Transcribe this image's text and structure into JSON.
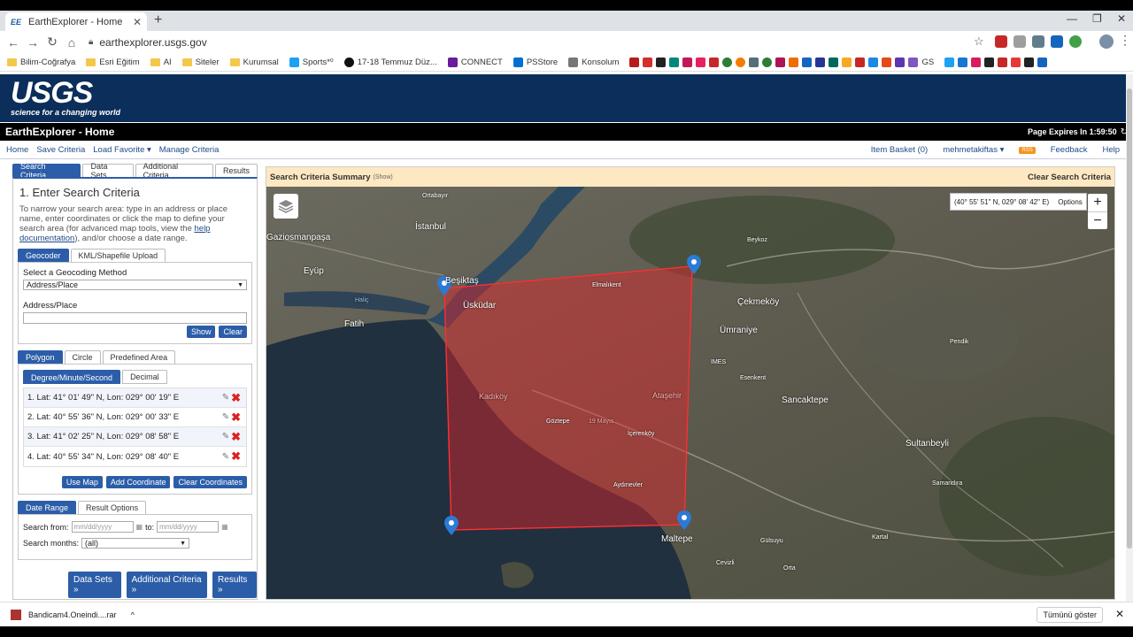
{
  "browser": {
    "tab_title": "EarthExplorer - Home",
    "tab_favicon": "EE",
    "url": "earthexplorer.usgs.gov",
    "bookmarks": [
      "Bilim-Coğrafya",
      "Esri Eğitim",
      "AI",
      "Siteler",
      "Kurumsal",
      "Sports*⁰",
      "17-18 Temmuz Düz...",
      "CONNECT",
      "PSStore",
      "Konsolum",
      "GS"
    ]
  },
  "header": {
    "logo": "USGS",
    "tagline": "science for a changing world",
    "page_title": "EarthExplorer - Home",
    "expires": "Page Expires In 1:59:50"
  },
  "menu": {
    "left": [
      "Home",
      "Save Criteria",
      "Load Favorite ▾",
      "Manage Criteria"
    ],
    "basket": "Item Basket (0)",
    "user": "mehmetakiftas ▾",
    "rss": "RSS",
    "feedback": "Feedback",
    "help": "Help"
  },
  "panel": {
    "tabs": [
      "Search Criteria",
      "Data Sets",
      "Additional Criteria",
      "Results"
    ],
    "heading": "1. Enter Search Criteria",
    "help_text": "To narrow your search area: type in an address or place name, enter coordinates or click the map to define your search area (for advanced map tools, view the",
    "help_link": "help documentation",
    "help_tail": "), and/or choose a date range.",
    "geo_tabs": [
      "Geocoder",
      "KML/Shapefile Upload"
    ],
    "geocode_label": "Select a Geocoding Method",
    "geocode_value": "Address/Place",
    "address_label": "Address/Place",
    "show": "Show",
    "clear": "Clear",
    "shape_tabs": [
      "Polygon",
      "Circle",
      "Predefined Area"
    ],
    "format_tabs": [
      "Degree/Minute/Second",
      "Decimal"
    ],
    "coords": [
      "1.  Lat: 41° 01' 49\" N, Lon: 029° 00' 19\" E",
      "2.  Lat: 40° 55' 36\" N, Lon: 029° 00' 33\" E",
      "3.  Lat: 41° 02' 25\" N, Lon: 029° 08' 58\" E",
      "4.  Lat: 40° 55' 34\" N, Lon: 029° 08' 40\" E"
    ],
    "use_map": "Use Map",
    "add_coord": "Add Coordinate",
    "clear_coords": "Clear Coordinates",
    "date_tabs": [
      "Date Range",
      "Result Options"
    ],
    "from_label": "Search from:",
    "to_label": "to:",
    "date_placeholder": "mm/dd/yyyy",
    "months_label": "Search months:",
    "months_value": "(all)",
    "bottom_buttons": [
      "Data Sets »",
      "Additional Criteria »",
      "Results »"
    ]
  },
  "map": {
    "summary_title": "Search Criteria Summary",
    "summary_show": "(Show)",
    "clear_criteria": "Clear Search Criteria",
    "coord_readout": "(40° 55' 51\" N, 029° 08' 42\" E)",
    "options": "Options",
    "zoom_in": "+",
    "zoom_out": "−",
    "labels": [
      "İstanbul",
      "Beşiktaş",
      "Üsküdar",
      "Fatih",
      "Eyüp",
      "Gaziosmanpaşa",
      "Kadıköy",
      "Ataşehir",
      "Ümraniye",
      "Çekmeköy",
      "Sancaktepe",
      "Sultanbeyli",
      "Maltepe",
      "Pendik",
      "Beykoz",
      "Elmalıkent",
      "IMES",
      "Esenkent",
      "Göztepe",
      "19 Mayıs",
      "İçerenköy",
      "Aydınevler",
      "Kartal",
      "Samandıra",
      "Haliç",
      "Ortabayır",
      "Gülsuyu",
      "Orta",
      "Cevizli"
    ]
  },
  "download": {
    "file": "Bandicam4.Oneindi....rar",
    "show_all": "Tümünü göster"
  },
  "colors": {
    "usgs_blue": "#0b2e5a",
    "tab_blue": "#2c5da8",
    "polygon": "#e8232b"
  }
}
